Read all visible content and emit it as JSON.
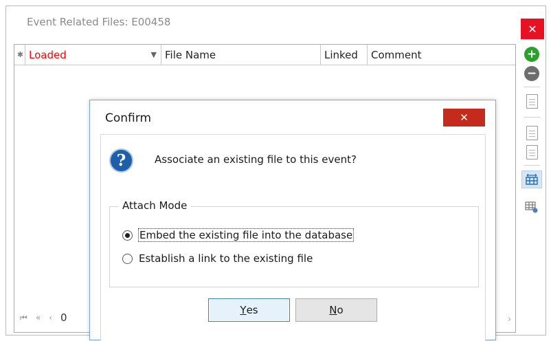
{
  "window": {
    "title": "Event Related Files:  E00458",
    "close_glyph": "✕"
  },
  "grid": {
    "star": "✱",
    "columns": [
      "Loaded",
      "File Name",
      "Linked",
      "Comment"
    ],
    "loaded_arrow": "▼",
    "nav": {
      "first": "⏮",
      "prev_page": "«",
      "prev": "‹",
      "page": "0",
      "next": "›"
    }
  },
  "toolbar": {
    "icons": [
      "add-icon",
      "remove-icon",
      "import-file-icon",
      "find-file-icon",
      "export-file-icon",
      "fit-columns-icon",
      "grid-settings-icon"
    ]
  },
  "dialog": {
    "title": "Confirm",
    "close_glyph": "✕",
    "question": "Associate an existing file to this event?",
    "group_title": "Attach Mode",
    "options": [
      {
        "label": "Embed the existing file into the database",
        "selected": true
      },
      {
        "label": "Establish a link to the existing file",
        "selected": false
      }
    ],
    "yes_first": "Y",
    "yes_rest": "es",
    "no_first": "N",
    "no_rest": "o"
  },
  "colors": {
    "loaded_header": "#ff0000",
    "close_bg": "#e81123",
    "add": "#2aa12a"
  }
}
